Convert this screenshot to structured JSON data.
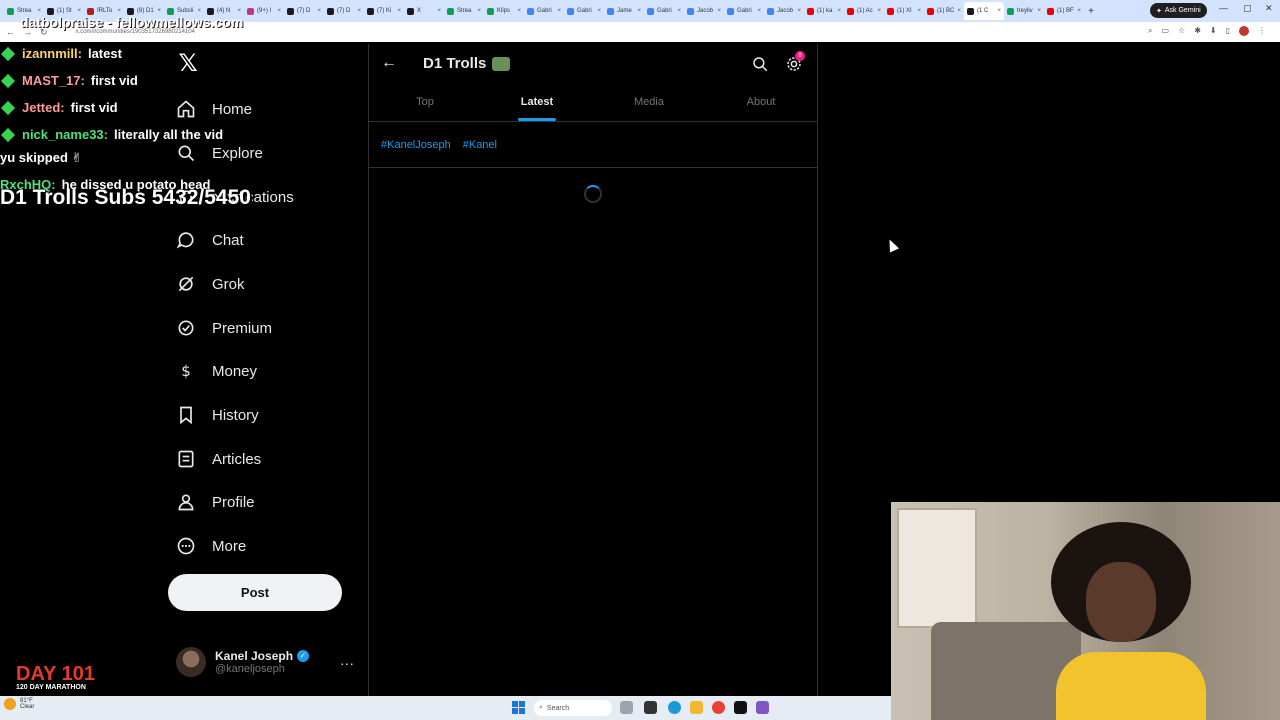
{
  "browser": {
    "tabs": [
      {
        "label": "Strea",
        "color": "#0f9d58"
      },
      {
        "label": "(1) St",
        "color": "#1a1a1a"
      },
      {
        "label": "IRLTo",
        "color": "#b71c1c"
      },
      {
        "label": "(8) D1",
        "color": "#1a1a1a"
      },
      {
        "label": "Subsli",
        "color": "#0f9d58"
      },
      {
        "label": "(4) N",
        "color": "#1a1a1a"
      },
      {
        "label": "(9+) I",
        "color": "#c13584"
      },
      {
        "label": "(7) D",
        "color": "#1a1a1a"
      },
      {
        "label": "(7) D",
        "color": "#1a1a1a"
      },
      {
        "label": "(7) Ki",
        "color": "#1a1a1a"
      },
      {
        "label": "X",
        "color": "#1a1a1a"
      },
      {
        "label": "Strea",
        "color": "#0f9d58"
      },
      {
        "label": "Klips",
        "color": "#0f9d58"
      },
      {
        "label": "Gabri",
        "color": "#4285f4"
      },
      {
        "label": "Gabri",
        "color": "#4285f4"
      },
      {
        "label": "Jame",
        "color": "#4285f4"
      },
      {
        "label": "Gabri",
        "color": "#4285f4"
      },
      {
        "label": "Jacob",
        "color": "#4285f4"
      },
      {
        "label": "Gabri",
        "color": "#4285f4"
      },
      {
        "label": "Jacob",
        "color": "#4285f4"
      },
      {
        "label": "(1) ka",
        "color": "#e00"
      },
      {
        "label": "(1) Ac",
        "color": "#e00"
      },
      {
        "label": "(1) XI",
        "color": "#e00"
      },
      {
        "label": "(1) BC",
        "color": "#e00"
      },
      {
        "label": "(1 C",
        "color": "#1a1a1a",
        "active": true
      },
      {
        "label": "treyliv",
        "color": "#0f9d58"
      },
      {
        "label": "(1) BF",
        "color": "#e00"
      }
    ],
    "gemini_label": "Ask Gemini",
    "url": "x.com/i/communities/1903517326980214104"
  },
  "stream": {
    "chat": [
      {
        "user": "izannmill:",
        "msg": "latest",
        "color": "y"
      },
      {
        "user": "MAST_17:",
        "msg": "first vid",
        "color": "r"
      },
      {
        "user": "Jetted:",
        "msg": "first vid",
        "color": "r"
      },
      {
        "user": "nick_name33:",
        "msg": "literally all the vid",
        "color": "g"
      }
    ],
    "chat_wrap": "yu skipped ✌",
    "chat_last_user": "RxchHQ:",
    "chat_last_msg": "he dissed u potato head",
    "top_text": "datbolpraise - fellowmellows.com",
    "subs_text": "D1 Trolls Subs 5432/5450",
    "day_text": "DAY 101",
    "marathon_text": "120 DAY MARATHON"
  },
  "nav": {
    "items": [
      {
        "label": "Home",
        "icon": "home-icon"
      },
      {
        "label": "Explore",
        "icon": "search-icon"
      },
      {
        "label": "Notifications",
        "icon": "bell-icon"
      },
      {
        "label": "Chat",
        "icon": "chat-icon"
      },
      {
        "label": "Grok",
        "icon": "grok-icon"
      },
      {
        "label": "Premium",
        "icon": "premium-icon"
      },
      {
        "label": "Money",
        "icon": "money-icon"
      },
      {
        "label": "History",
        "icon": "bookmark-icon"
      },
      {
        "label": "Articles",
        "icon": "articles-icon"
      },
      {
        "label": "Profile",
        "icon": "profile-icon"
      },
      {
        "label": "More",
        "icon": "more-icon"
      }
    ],
    "post_label": "Post",
    "account_name": "Kanel Joseph",
    "account_handle": "@kaneljoseph"
  },
  "main": {
    "title": "D1 Trolls",
    "notif_count": "8",
    "tabs": [
      "Top",
      "Latest",
      "Media",
      "About"
    ],
    "active_tab": "Latest",
    "tags": [
      "#KanelJoseph",
      "#Kanel"
    ]
  },
  "taskbar": {
    "weather_temp": "81°F",
    "weather_desc": "Clear",
    "search_placeholder": "Search"
  },
  "colors": {
    "accent": "#1d9bf0",
    "background": "#000000",
    "text": "#e7e9ea",
    "muted": "#71767b",
    "border": "#2f3336"
  }
}
